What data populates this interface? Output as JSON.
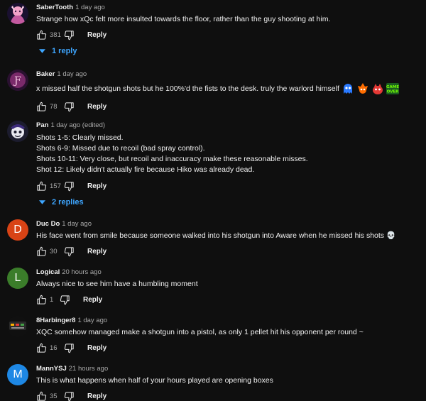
{
  "comments": [
    {
      "author": "SaberTooth",
      "time": "1 day ago",
      "text": "Strange how xQc felt more insulted towards the floor, rather than the guy shooting at him.",
      "likes": "381",
      "reply_label": "Reply",
      "replies_label": "1 reply",
      "avatar_icon": "saber-avatar"
    },
    {
      "author": "Baker",
      "time": "1 day ago",
      "text": "x missed half the shotgun shots but he 100%'d the fists to the desk. truly the warlord himself",
      "likes": "78",
      "reply_label": "Reply",
      "emotes": [
        "blue-ghost-emote",
        "fire-creature-emote",
        "red-creature-emote",
        "game-over-emote"
      ],
      "avatar_icon": "baker-avatar"
    },
    {
      "author": "Pan",
      "time": "1 day ago (edited)",
      "lines": [
        "Shots 1-5: Clearly missed.",
        "Shots 6-9: Missed due to recoil (bad spray control).",
        "Shots 10-11: Very close, but recoil and inaccuracy make these reasonable misses.",
        "Shot 12: Likely didn't actually fire because Hiko was already dead."
      ],
      "likes": "157",
      "reply_label": "Reply",
      "replies_label": "2 replies",
      "avatar_icon": "pan-avatar"
    },
    {
      "author": "Duc Do",
      "time": "1 day ago",
      "text": "His face went from smile because someone walked into his shotgun into Aware when he missed his shots 💀",
      "likes": "30",
      "reply_label": "Reply",
      "avatar_letter": "D",
      "avatar_color": "#d84315"
    },
    {
      "author": "Logical",
      "time": "20 hours ago",
      "text": "Always nice to see him have a humbling moment",
      "likes": "1",
      "reply_label": "Reply",
      "avatar_letter": "L",
      "avatar_color": "#3b7d2a"
    },
    {
      "author": "8Harbinger8",
      "time": "1 day ago",
      "text": "XQC somehow managed make a shotgun into a pistol, as only 1 pellet hit his opponent per round ~",
      "likes": "16",
      "reply_label": "Reply",
      "avatar_icon": "harbinger-avatar"
    },
    {
      "author": "MannYSJ",
      "time": "21 hours ago",
      "text": "This is what happens when half of your hours played are opening boxes",
      "likes": "35",
      "reply_label": "Reply",
      "avatar_letter": "M",
      "avatar_color": "#1e88e5"
    }
  ],
  "colors": {
    "background": "#0f0f0f",
    "text": "#f1f1f1",
    "muted": "#aaaaaa",
    "link": "#3ea6ff"
  }
}
